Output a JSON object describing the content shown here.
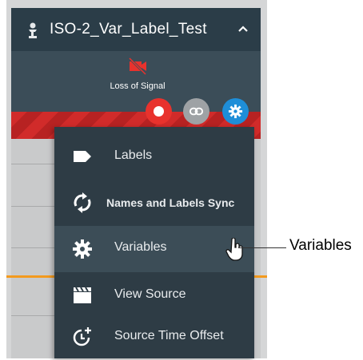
{
  "tile": {
    "title": "ISO-2_Var_Label_Test",
    "status_text": "Loss of Signal",
    "icons": {
      "source": "person-icon",
      "collapse": "chevron-up-icon",
      "status": "video-off-icon",
      "record": "record-icon",
      "link": "link-icon",
      "settings": "gear-icon"
    }
  },
  "menu": {
    "items": [
      {
        "label": "Labels",
        "icon": "label-tag-icon"
      },
      {
        "label": "Names and Labels Sync",
        "icon": "sync-icon"
      },
      {
        "label": "Variables",
        "icon": "gear-icon"
      },
      {
        "label": "View Source",
        "icon": "clapperboard-icon"
      },
      {
        "label": "Source Time Offset",
        "icon": "clock-plus-icon"
      }
    ],
    "hovered_index": 2
  },
  "callout": {
    "label": "Variables"
  },
  "colors": {
    "header": "#2b3d48",
    "menu_bg": "#2e3c45",
    "record": "#e8322d",
    "link": "#9ea2a5",
    "settings": "#1e8ed8",
    "no_signal_stripes": "#d12b2a",
    "accent_line": "#f39a1e"
  }
}
